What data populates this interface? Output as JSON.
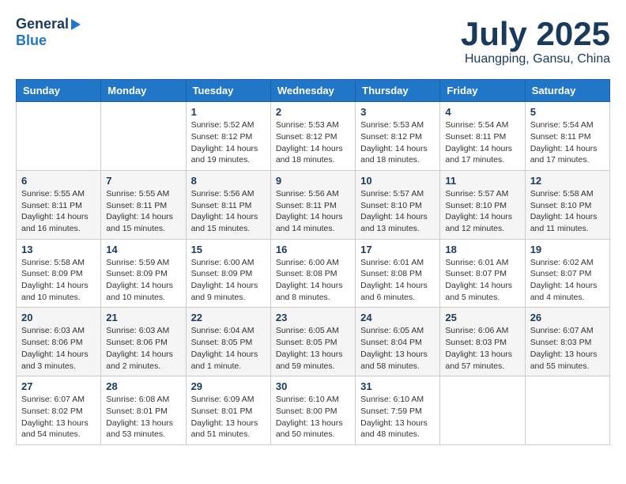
{
  "header": {
    "logo_general": "General",
    "logo_blue": "Blue",
    "month_title": "July 2025",
    "location": "Huangping, Gansu, China"
  },
  "weekdays": [
    "Sunday",
    "Monday",
    "Tuesday",
    "Wednesday",
    "Thursday",
    "Friday",
    "Saturday"
  ],
  "weeks": [
    [
      {
        "day": "",
        "info": ""
      },
      {
        "day": "",
        "info": ""
      },
      {
        "day": "1",
        "info": "Sunrise: 5:52 AM\nSunset: 8:12 PM\nDaylight: 14 hours and 19 minutes."
      },
      {
        "day": "2",
        "info": "Sunrise: 5:53 AM\nSunset: 8:12 PM\nDaylight: 14 hours and 18 minutes."
      },
      {
        "day": "3",
        "info": "Sunrise: 5:53 AM\nSunset: 8:12 PM\nDaylight: 14 hours and 18 minutes."
      },
      {
        "day": "4",
        "info": "Sunrise: 5:54 AM\nSunset: 8:11 PM\nDaylight: 14 hours and 17 minutes."
      },
      {
        "day": "5",
        "info": "Sunrise: 5:54 AM\nSunset: 8:11 PM\nDaylight: 14 hours and 17 minutes."
      }
    ],
    [
      {
        "day": "6",
        "info": "Sunrise: 5:55 AM\nSunset: 8:11 PM\nDaylight: 14 hours and 16 minutes."
      },
      {
        "day": "7",
        "info": "Sunrise: 5:55 AM\nSunset: 8:11 PM\nDaylight: 14 hours and 15 minutes."
      },
      {
        "day": "8",
        "info": "Sunrise: 5:56 AM\nSunset: 8:11 PM\nDaylight: 14 hours and 15 minutes."
      },
      {
        "day": "9",
        "info": "Sunrise: 5:56 AM\nSunset: 8:11 PM\nDaylight: 14 hours and 14 minutes."
      },
      {
        "day": "10",
        "info": "Sunrise: 5:57 AM\nSunset: 8:10 PM\nDaylight: 14 hours and 13 minutes."
      },
      {
        "day": "11",
        "info": "Sunrise: 5:57 AM\nSunset: 8:10 PM\nDaylight: 14 hours and 12 minutes."
      },
      {
        "day": "12",
        "info": "Sunrise: 5:58 AM\nSunset: 8:10 PM\nDaylight: 14 hours and 11 minutes."
      }
    ],
    [
      {
        "day": "13",
        "info": "Sunrise: 5:58 AM\nSunset: 8:09 PM\nDaylight: 14 hours and 10 minutes."
      },
      {
        "day": "14",
        "info": "Sunrise: 5:59 AM\nSunset: 8:09 PM\nDaylight: 14 hours and 10 minutes."
      },
      {
        "day": "15",
        "info": "Sunrise: 6:00 AM\nSunset: 8:09 PM\nDaylight: 14 hours and 9 minutes."
      },
      {
        "day": "16",
        "info": "Sunrise: 6:00 AM\nSunset: 8:08 PM\nDaylight: 14 hours and 8 minutes."
      },
      {
        "day": "17",
        "info": "Sunrise: 6:01 AM\nSunset: 8:08 PM\nDaylight: 14 hours and 6 minutes."
      },
      {
        "day": "18",
        "info": "Sunrise: 6:01 AM\nSunset: 8:07 PM\nDaylight: 14 hours and 5 minutes."
      },
      {
        "day": "19",
        "info": "Sunrise: 6:02 AM\nSunset: 8:07 PM\nDaylight: 14 hours and 4 minutes."
      }
    ],
    [
      {
        "day": "20",
        "info": "Sunrise: 6:03 AM\nSunset: 8:06 PM\nDaylight: 14 hours and 3 minutes."
      },
      {
        "day": "21",
        "info": "Sunrise: 6:03 AM\nSunset: 8:06 PM\nDaylight: 14 hours and 2 minutes."
      },
      {
        "day": "22",
        "info": "Sunrise: 6:04 AM\nSunset: 8:05 PM\nDaylight: 14 hours and 1 minute."
      },
      {
        "day": "23",
        "info": "Sunrise: 6:05 AM\nSunset: 8:05 PM\nDaylight: 13 hours and 59 minutes."
      },
      {
        "day": "24",
        "info": "Sunrise: 6:05 AM\nSunset: 8:04 PM\nDaylight: 13 hours and 58 minutes."
      },
      {
        "day": "25",
        "info": "Sunrise: 6:06 AM\nSunset: 8:03 PM\nDaylight: 13 hours and 57 minutes."
      },
      {
        "day": "26",
        "info": "Sunrise: 6:07 AM\nSunset: 8:03 PM\nDaylight: 13 hours and 55 minutes."
      }
    ],
    [
      {
        "day": "27",
        "info": "Sunrise: 6:07 AM\nSunset: 8:02 PM\nDaylight: 13 hours and 54 minutes."
      },
      {
        "day": "28",
        "info": "Sunrise: 6:08 AM\nSunset: 8:01 PM\nDaylight: 13 hours and 53 minutes."
      },
      {
        "day": "29",
        "info": "Sunrise: 6:09 AM\nSunset: 8:01 PM\nDaylight: 13 hours and 51 minutes."
      },
      {
        "day": "30",
        "info": "Sunrise: 6:10 AM\nSunset: 8:00 PM\nDaylight: 13 hours and 50 minutes."
      },
      {
        "day": "31",
        "info": "Sunrise: 6:10 AM\nSunset: 7:59 PM\nDaylight: 13 hours and 48 minutes."
      },
      {
        "day": "",
        "info": ""
      },
      {
        "day": "",
        "info": ""
      }
    ]
  ]
}
